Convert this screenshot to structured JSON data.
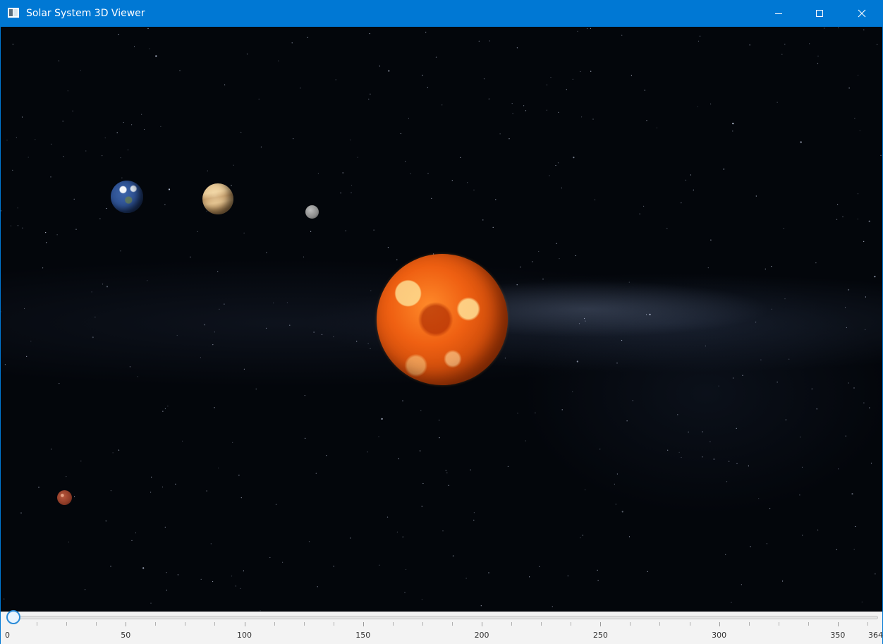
{
  "window": {
    "title": "Solar System 3D Viewer",
    "accent_color": "#0078d4",
    "controls": [
      "minimize-icon",
      "maximize-icon",
      "close-icon"
    ]
  },
  "scene": {
    "background": "starfield with milky way",
    "bodies": [
      {
        "name": "sun",
        "color": "#ef6012"
      },
      {
        "name": "earth",
        "color": "#3d64a8"
      },
      {
        "name": "venus",
        "color": "#d1a870"
      },
      {
        "name": "mercury",
        "color": "#8a8a8a"
      },
      {
        "name": "mars",
        "color": "#b8573d"
      }
    ]
  },
  "timeline": {
    "min": 0,
    "max": 364,
    "value": 0,
    "major_step": 50,
    "minor_step": 12.5,
    "labels": [
      "0",
      "50",
      "100",
      "150",
      "200",
      "250",
      "300",
      "350",
      "364"
    ]
  }
}
